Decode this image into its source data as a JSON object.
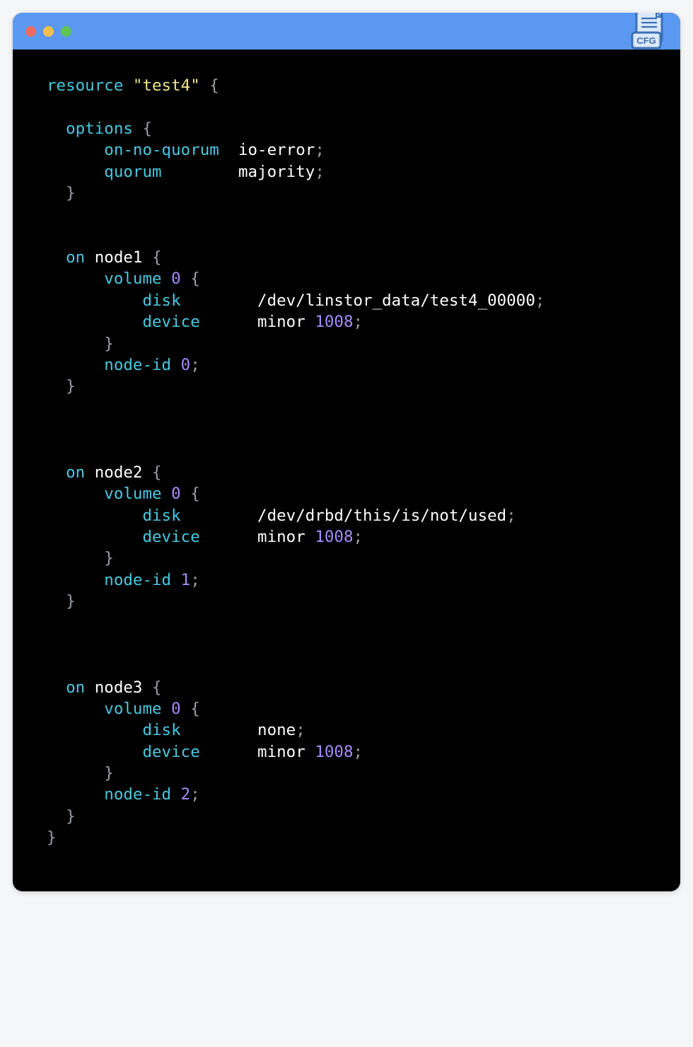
{
  "badge_label": "CFG",
  "resource_kw": "resource",
  "resource_name": "\"test4\"",
  "options_kw": "options",
  "on_kw": "on",
  "volume_kw": "volume",
  "disk_kw": "disk",
  "device_kw": "device",
  "node_id_kw": "node-id",
  "minor_kw": "minor",
  "nodes": {
    "options": {
      "on_no_quorum_key": "on-no-quorum",
      "on_no_quorum_val": "io-error",
      "quorum_key": "quorum",
      "quorum_val": "majority"
    },
    "n1": {
      "name": "node1",
      "vol_idx": "0",
      "disk": "/dev/linstor_data/test4_00000",
      "minor": "1008",
      "node_id": "0"
    },
    "n2": {
      "name": "node2",
      "vol_idx": "0",
      "disk": "/dev/drbd/this/is/not/used",
      "minor": "1008",
      "node_id": "1"
    },
    "n3": {
      "name": "node3",
      "vol_idx": "0",
      "disk": "none",
      "minor": "1008",
      "node_id": "2"
    }
  }
}
